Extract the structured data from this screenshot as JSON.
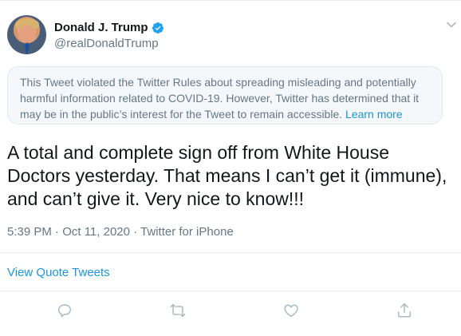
{
  "author": {
    "display_name": "Donald J. Trump",
    "handle": "@realDonaldTrump",
    "verified": true
  },
  "notice": {
    "text": "This Tweet violated the Twitter Rules about spreading misleading and potentially harmful information related to COVID-19. However, Twitter has determined that it may be in the public’s interest for the Tweet to remain accessible.",
    "link_label": "Learn more"
  },
  "tweet": {
    "text": "A total and complete sign off from White House Doctors yesterday. That means I can’t get it (immune), and can’t give it. Very nice to know!!!",
    "meta": "5:39 PM · Oct 11, 2020 · Twitter for iPhone"
  },
  "links": {
    "view_quote_tweets": "View Quote Tweets"
  },
  "actions": [
    "reply-icon",
    "retweet-icon",
    "like-icon",
    "share-icon"
  ],
  "colors": {
    "accent": "#1b95e0",
    "text_primary": "#14171a",
    "text_secondary": "#657786",
    "icon_gray": "#aab8c2",
    "notice_bg": "#f5f8fa",
    "border": "#e6ecf0"
  }
}
